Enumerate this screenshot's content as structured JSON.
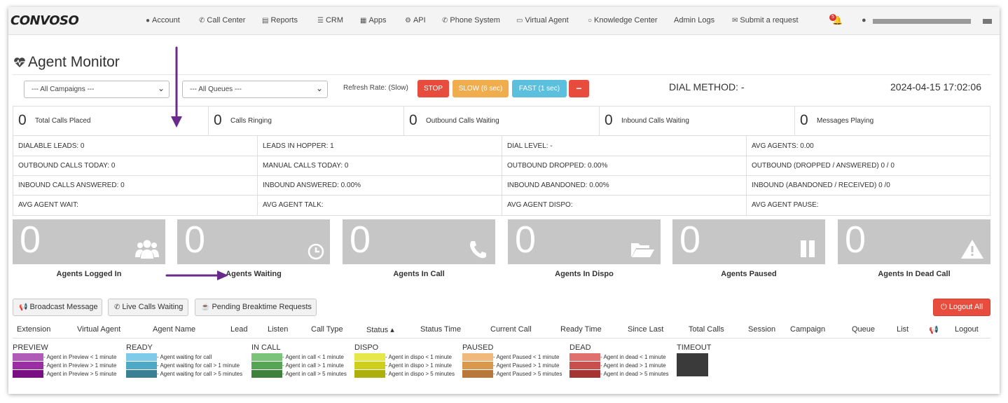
{
  "brand": "CONVOSO",
  "nav": [
    {
      "label": "Account",
      "icon": "user-icon"
    },
    {
      "label": "Call Center",
      "icon": "phone-icon"
    },
    {
      "label": "Reports",
      "icon": "bar-chart-icon"
    },
    {
      "label": "CRM",
      "icon": "list-icon"
    },
    {
      "label": "Apps",
      "icon": "grid-icon"
    },
    {
      "label": "API",
      "icon": "gear-icon"
    },
    {
      "label": "Phone System",
      "icon": "phone-icon"
    },
    {
      "label": "Virtual Agent",
      "icon": "monitor-icon"
    },
    {
      "label": "Knowledge Center",
      "icon": "lightbulb-icon"
    },
    {
      "label": "Admin Logs",
      "icon": ""
    },
    {
      "label": "Submit a request",
      "icon": "ticket-icon"
    }
  ],
  "notifications": {
    "count": "5"
  },
  "page": {
    "title": "Agent Monitor"
  },
  "filters": {
    "campaigns": "--- All Campaigns ---",
    "queues": "--- All Queues ---"
  },
  "refresh": {
    "label": "Refresh Rate: (Slow)",
    "stop": "STOP",
    "slow": "SLOW (6 sec)",
    "fast": "FAST (1 sec)",
    "minus": "−"
  },
  "dial_method": "DIAL METHOD: -",
  "datetime": "2024-04-15 17:02:06",
  "stats": [
    {
      "value": "0",
      "label": "Total Calls Placed"
    },
    {
      "value": "0",
      "label": "Calls Ringing"
    },
    {
      "value": "0",
      "label": "Outbound Calls Waiting"
    },
    {
      "value": "0",
      "label": "Inbound Calls Waiting"
    },
    {
      "value": "0",
      "label": "Messages Playing"
    }
  ],
  "info": [
    [
      "DIALABLE LEADS: 0",
      "LEADS IN HOPPER: 1",
      "DIAL LEVEL: -",
      "AVG AGENTS: 0.00"
    ],
    [
      "OUTBOUND CALLS TODAY: 0",
      "MANUAL CALLS TODAY: 0",
      "OUTBOUND DROPPED: 0.00%",
      "OUTBOUND (DROPPED / ANSWERED) 0 / 0"
    ],
    [
      "INBOUND CALLS ANSWERED: 0",
      "INBOUND ANSWERED: 0.00%",
      "INBOUND ABANDONED: 0.00%",
      "INBOUND (ABANDONED / RECEIVED) 0 /0"
    ],
    [
      "AVG AGENT WAIT:",
      "AVG AGENT TALK:",
      "AVG AGENT DISPO:",
      "AVG AGENT PAUSE:"
    ]
  ],
  "tiles": [
    {
      "value": "0",
      "label": "Agents Logged In",
      "icon": "users-icon"
    },
    {
      "value": "0",
      "label": "Agents Waiting",
      "icon": "clock-icon"
    },
    {
      "value": "0",
      "label": "Agents In Call",
      "icon": "phone-icon"
    },
    {
      "value": "0",
      "label": "Agents In Dispo",
      "icon": "folder-open-icon"
    },
    {
      "value": "0",
      "label": "Agents Paused",
      "icon": "pause-icon"
    },
    {
      "value": "0",
      "label": "Agents In Dead Call",
      "icon": "warning-icon"
    }
  ],
  "actions": {
    "broadcast": "Broadcast Message",
    "live_calls": "Live Calls Waiting",
    "breaktime": "Pending Breaktime Requests",
    "logout_all": "Logout All"
  },
  "columns": [
    "Extension",
    "Virtual Agent",
    "Agent Name",
    "Lead",
    "Listen",
    "Call Type",
    "Status ▴",
    "Status Time",
    "Current Call",
    "Ready Time",
    "Since Last",
    "Total Calls",
    "Session",
    "Campaign",
    "Queue",
    "List",
    "",
    "Logout"
  ],
  "legend": [
    {
      "title": "PREVIEW",
      "colors": [
        "#b05bb8",
        "#9a2fa3",
        "#7a0f83"
      ],
      "labels": [
        "- Agent in Preview < 1 minute",
        "- Agent in Preview > 1 minute",
        "- Agent in Preview > 5 minute"
      ]
    },
    {
      "title": "READY",
      "colors": [
        "#7dcbe8",
        "#4fa8c4",
        "#3a7f92"
      ],
      "labels": [
        "- Agent waiting for call",
        "- Agent waiting for call > 1 minute",
        "- Agent waiting for call > 5 minutes"
      ]
    },
    {
      "title": "IN CALL",
      "colors": [
        "#7cc37a",
        "#56a455",
        "#3f803d"
      ],
      "labels": [
        "- Agent in call < 1 minute",
        "- Agent in call > 1 minute",
        "- Agent in call > 5 minutes"
      ]
    },
    {
      "title": "DISPO",
      "colors": [
        "#e6e84a",
        "#cdcf1a",
        "#adaf0c"
      ],
      "labels": [
        "- Agent in dispo < 1 minute",
        "- Agent in dispo > 1 minute",
        "- Agent in dispo > 5 minutes"
      ]
    },
    {
      "title": "PAUSED",
      "colors": [
        "#f0b87a",
        "#d8994f",
        "#b7783a"
      ],
      "labels": [
        "- Agent Paused < 1 minute",
        "- Agent Paused > 1 minute",
        "- Agent Paused > 5 minutes"
      ]
    },
    {
      "title": "DEAD",
      "colors": [
        "#e0706e",
        "#c94f4d",
        "#a63432"
      ],
      "labels": [
        "- Agent in dead < 1 minute",
        "- Agent in dead > 1 minute",
        "- Agent in dead > 5 minutes"
      ]
    },
    {
      "title": "TIMEOUT",
      "colors": [
        "#3a3a3a"
      ],
      "labels": []
    }
  ]
}
